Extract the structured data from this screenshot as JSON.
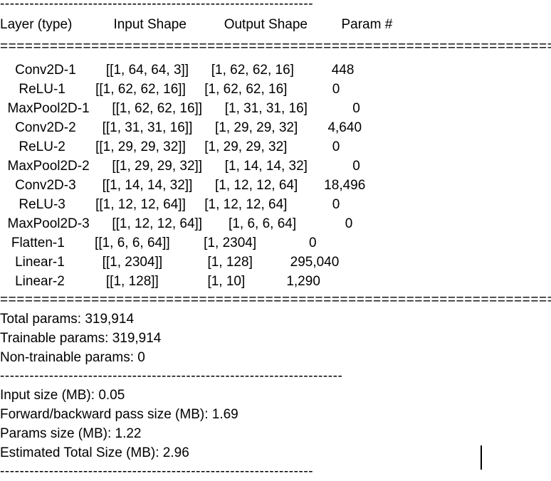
{
  "document": {
    "kind": "model-summary-text-output",
    "background_color": "#ffffff",
    "text_color": "#000000"
  },
  "separators": {
    "top_dashed": "----------------------------------------------------------------",
    "header_equals": "==========================================================================",
    "body_equals": "==========================================================================",
    "mid_dashed": "----------------------------------------------------------------------",
    "bottom_dashed": "----------------------------------------------------------------"
  },
  "table": {
    "columns": [
      {
        "label": "Layer (type)"
      },
      {
        "label": "Input Shape"
      },
      {
        "label": "Output Shape"
      },
      {
        "label": "Param #"
      }
    ],
    "header_line": "Layer (type)           Input Shape          Output Shape         Param #",
    "rows": [
      {
        "layer": "Conv2D-1",
        "input_shape": "[[1, 64, 64, 3]]",
        "output_shape": "[1, 62, 62, 16]",
        "params": "448",
        "line": "    Conv2D-1        [[1, 64, 64, 3]]      [1, 62, 62, 16]          448"
      },
      {
        "layer": "ReLU-1",
        "input_shape": "[[1, 62, 62, 16]]",
        "output_shape": "[1, 62, 62, 16]",
        "params": "0",
        "line": "     ReLU-1        [[1, 62, 62, 16]]     [1, 62, 62, 16]            0"
      },
      {
        "layer": "MaxPool2D-1",
        "input_shape": "[[1, 62, 62, 16]]",
        "output_shape": "[1, 31, 31, 16]",
        "params": "0",
        "line": "  MaxPool2D-1      [[1, 62, 62, 16]]      [1, 31, 31, 16]            0"
      },
      {
        "layer": "Conv2D-2",
        "input_shape": "[[1, 31, 31, 16]]",
        "output_shape": "[1, 29, 29, 32]",
        "params": "4,640",
        "line": "    Conv2D-2       [[1, 31, 31, 16]]      [1, 29, 29, 32]        4,640"
      },
      {
        "layer": "ReLU-2",
        "input_shape": "[[1, 29, 29, 32]]",
        "output_shape": "[1, 29, 29, 32]",
        "params": "0",
        "line": "     ReLU-2        [[1, 29, 29, 32]]     [1, 29, 29, 32]            0"
      },
      {
        "layer": "MaxPool2D-2",
        "input_shape": "[[1, 29, 29, 32]]",
        "output_shape": "[1, 14, 14, 32]",
        "params": "0",
        "line": "  MaxPool2D-2      [[1, 29, 29, 32]]      [1, 14, 14, 32]            0"
      },
      {
        "layer": "Conv2D-3",
        "input_shape": "[[1, 14, 14, 32]]",
        "output_shape": "[1, 12, 12, 64]",
        "params": "18,496",
        "line": "    Conv2D-3       [[1, 14, 14, 32]]      [1, 12, 12, 64]       18,496"
      },
      {
        "layer": "ReLU-3",
        "input_shape": "[[1, 12, 12, 64]]",
        "output_shape": "[1, 12, 12, 64]",
        "params": "0",
        "line": "     ReLU-3        [[1, 12, 12, 64]]     [1, 12, 12, 64]            0"
      },
      {
        "layer": "MaxPool2D-3",
        "input_shape": "[[1, 12, 12, 64]]",
        "output_shape": "[1, 6, 6, 64]",
        "params": "0",
        "line": "  MaxPool2D-3      [[1, 12, 12, 64]]       [1, 6, 6, 64]             0"
      },
      {
        "layer": "Flatten-1",
        "input_shape": "[[1, 6, 6, 64]]",
        "output_shape": "[1, 2304]",
        "params": "0",
        "line": "   Flatten-1        [[1, 6, 6, 64]]         [1, 2304]              0"
      },
      {
        "layer": "Linear-1",
        "input_shape": "[[1, 2304]]",
        "output_shape": "[1, 128]",
        "params": "295,040",
        "line": "    Linear-1          [[1, 2304]]            [1, 128]          295,040"
      },
      {
        "layer": "Linear-2",
        "input_shape": "[[1, 128]]",
        "output_shape": "[1, 10]",
        "params": "1,290",
        "line": "    Linear-2           [[1, 128]]             [1, 10]           1,290"
      }
    ]
  },
  "param_summary": {
    "total_params_label": "Total params:",
    "total_params_value": "319,914",
    "total_params_line": "Total params: 319,914",
    "trainable_params_label": "Trainable params:",
    "trainable_params_value": "319,914",
    "trainable_params_line": "Trainable params: 319,914",
    "non_trainable_params_label": "Non-trainable params:",
    "non_trainable_params_value": "0",
    "non_trainable_params_line": "Non-trainable params: 0"
  },
  "size_summary": {
    "input_size_line": "Input size (MB): 0.05",
    "input_size_label": "Input size (MB):",
    "input_size_value": "0.05",
    "forward_backward_line": "Forward/backward pass size (MB): 1.69",
    "forward_backward_label": "Forward/backward pass size (MB):",
    "forward_backward_value": "1.69",
    "params_size_line": "Params size (MB): 1.22",
    "params_size_label": "Params size (MB):",
    "params_size_value": "1.22",
    "estimated_total_line": "Estimated Total Size (MB): 2.96",
    "estimated_total_label": "Estimated Total Size (MB):",
    "estimated_total_value": "2.96"
  },
  "cursor": {
    "visible": true
  }
}
